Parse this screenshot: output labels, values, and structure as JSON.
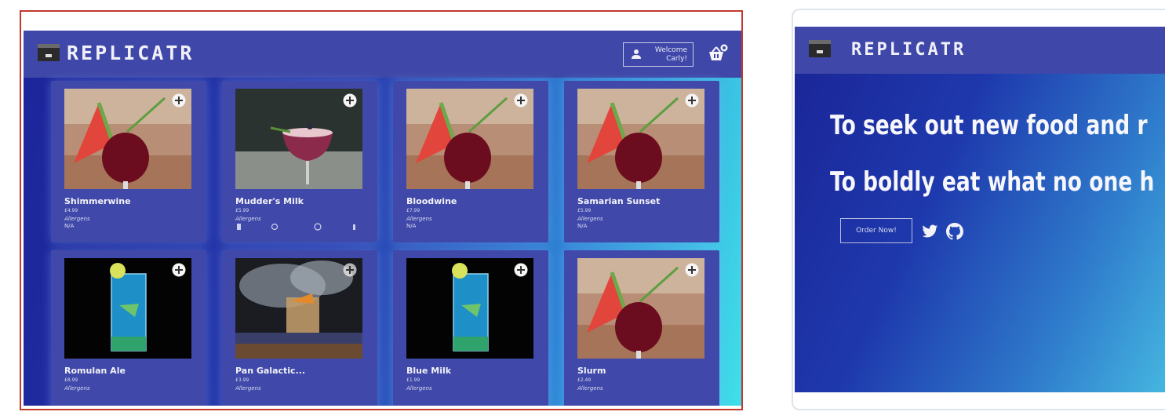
{
  "left": {
    "brand": "REPLICATR",
    "welcome_line1": "Welcome",
    "welcome_line2": "Carly!",
    "cards": [
      {
        "name": "Shimmerwine",
        "price": "£4.99",
        "allergens": "Allergens",
        "allergen_info": "N/A"
      },
      {
        "name": "Mudder's Milk",
        "price": "£5.99",
        "allergens": "Allergens"
      },
      {
        "name": "Bloodwine",
        "price": "£7.99",
        "allergens": "Allergens",
        "allergen_info": "N/A"
      },
      {
        "name": "Samarian Sunset",
        "price": "£5.99",
        "allergens": "Allergens",
        "allergen_info": "N/A"
      },
      {
        "name": "Romulan Ale",
        "price": "£8.99",
        "allergens": "Allergens"
      },
      {
        "name": "Pan Galactic...",
        "price": "£3.99",
        "allergens": "Allergens"
      },
      {
        "name": "Blue Milk",
        "price": "£1.99",
        "allergens": "Allergens"
      },
      {
        "name": "Slurm",
        "price": "£2.49",
        "allergens": "Allergens"
      }
    ]
  },
  "right": {
    "brand": "REPLICATR",
    "tagline1": "To seek out new food and r",
    "tagline2": "To boldly eat what no one h",
    "order_button": "Order Now!"
  },
  "icons": {
    "user": "user-icon",
    "basket": "basket-icon",
    "add": "plus-circle-icon",
    "twitter": "twitter-icon",
    "github": "github-icon"
  }
}
